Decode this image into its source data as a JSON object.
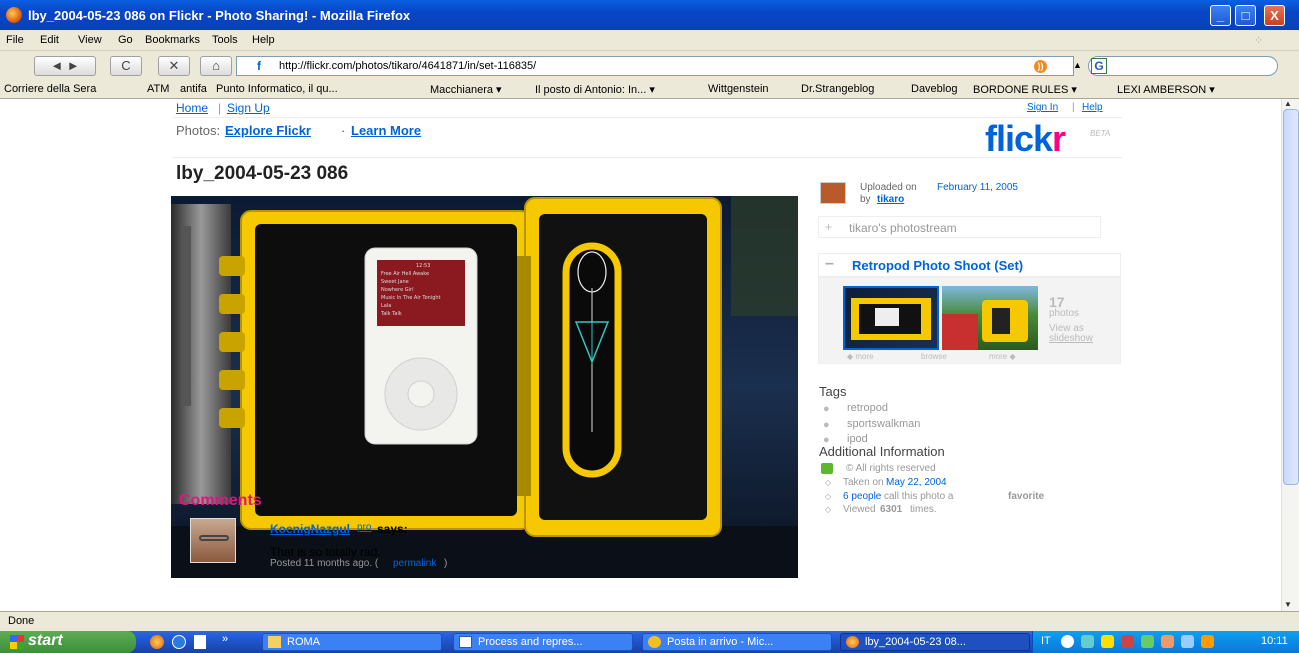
{
  "window": {
    "title": "lby_2004-05-23 086 on Flickr - Photo Sharing! - Mozilla Firefox",
    "minimize": "_",
    "maximize": "□",
    "close": "X"
  },
  "menu": [
    "File",
    "Edit",
    "View",
    "Go",
    "Bookmarks",
    "Tools",
    "Help"
  ],
  "nav": {
    "back": "◄ ►",
    "reload": "C",
    "stop": "✕",
    "home": "⌂",
    "url": "http://flickr.com/photos/tikaro/4641871/in/set-116835/",
    "search_placeholder": ""
  },
  "bookmarks": [
    "Corriere della Sera",
    "ATM",
    "antifa",
    "Punto Informatico, il qu...",
    "Macchianera ▾",
    "Il posto di Antonio: In... ▾",
    "Wittgenstein",
    "Dr.Strangeblog",
    "Daveblog",
    "BORDONE RULES ▾",
    "LEXI AMBERSON ▾"
  ],
  "page": {
    "top_links": {
      "home": "Home",
      "sep": "|",
      "signup": "Sign Up",
      "signin": "Sign In",
      "help": "Help"
    },
    "photos_label": "Photos:",
    "explore": "Explore Flickr",
    "bullet": "·",
    "learn_more": "Learn More",
    "logo_main": "flick",
    "logo_r": "r",
    "logo_beta": "BETA",
    "photo_title": "lby_2004-05-23 086",
    "uploaded_prefix": "Uploaded on",
    "uploaded_date": "February 11, 2005",
    "by": "by",
    "owner": "tikaro",
    "photostream": "tikaro's photostream",
    "set_title": "Retropod Photo Shoot (Set)",
    "set_count": "17",
    "set_photos": "photos",
    "view_as": "View as",
    "slideshow": "slideshow",
    "prev_more": "◆ more",
    "browse": "browse",
    "next_more": "more ◆",
    "tags_heading": "Tags",
    "tags": [
      "retropod",
      "sportswalkman",
      "ipod"
    ],
    "additional_heading": "Additional Information",
    "rights": "© All rights reserved",
    "taken_prefix": "Taken on",
    "taken_date": "May 22, 2004",
    "fav_people": "6 people",
    "fav_text": "call this photo a",
    "fav_word": "favorite",
    "viewed_prefix": "Viewed",
    "viewed_count": "6301",
    "viewed_suffix": "times.",
    "comments_heading": "Comments",
    "commenter": "KoenigNazgul",
    "pro": "pro",
    "says": "says:",
    "comment_text": "That is so totally rad.",
    "posted": "Posted 11 months ago. (",
    "permalink": "permalink",
    "posted_end": ")",
    "ipod_screen": [
      "12:53",
      "Free Air Hell Awake",
      "Sweet Jane",
      "Nowhere Girl",
      "Music In The Air Tonight",
      "Lala",
      "Talk Talk"
    ]
  },
  "status": "Done",
  "taskbar": {
    "start": "start",
    "quick_more": "»",
    "items": [
      "ROMA",
      "Process and repres...",
      "Posta in arrivo - Mic...",
      "lby_2004-05-23 08..."
    ],
    "lang": "IT",
    "clock": "10:11"
  },
  "colors": {
    "flickr_blue": "#0063dc",
    "flickr_pink": "#ff0084",
    "comments_pink": "#e0147f",
    "case_yellow": "#f5c800",
    "xp_blue": "#0a5fe0"
  }
}
